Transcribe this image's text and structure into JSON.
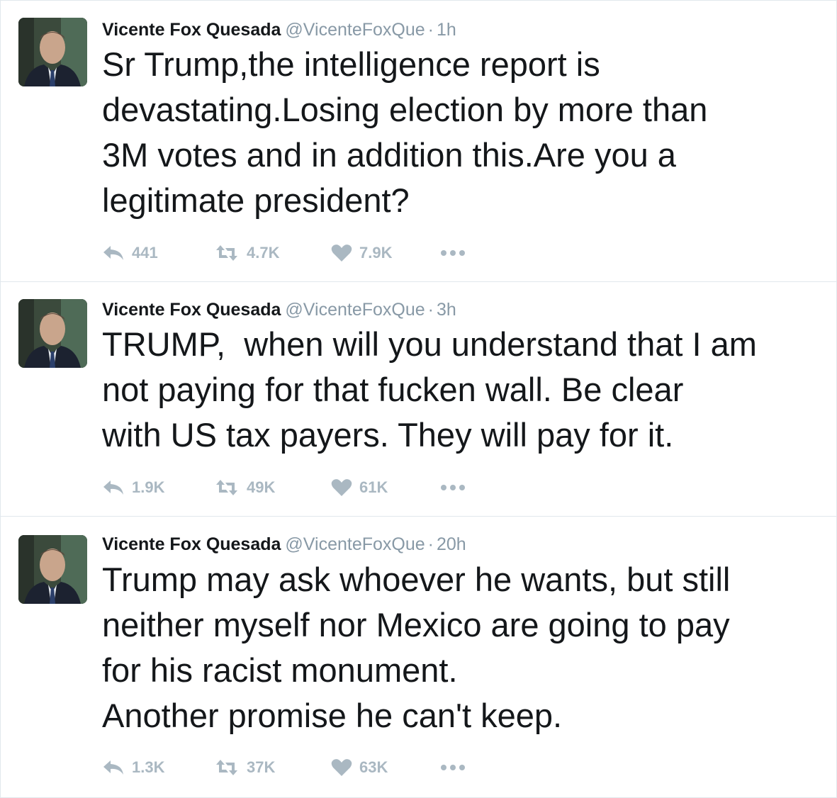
{
  "tweets": [
    {
      "name": "Vicente Fox Quesada",
      "handle": "@VicenteFoxQue",
      "separator": "·",
      "time": "1h",
      "text": "Sr Trump,the intelligence report is\ndevastating.Losing election by more than\n3M votes and in addition this.Are you a\nlegitimate president?",
      "replies": "441",
      "retweets": "4.7K",
      "likes": "7.9K"
    },
    {
      "name": "Vicente Fox Quesada",
      "handle": "@VicenteFoxQue",
      "separator": "·",
      "time": "3h",
      "text": "TRUMP,  when will you understand that I am\nnot paying for that fucken wall. Be clear\nwith US tax payers. They will pay for it.",
      "replies": "1.9K",
      "retweets": "49K",
      "likes": "61K"
    },
    {
      "name": "Vicente Fox Quesada",
      "handle": "@VicenteFoxQue",
      "separator": "·",
      "time": "20h",
      "text": "Trump may ask whoever he wants, but still\nneither myself nor Mexico are going to pay\nfor his racist monument.\nAnother promise he can't keep.",
      "replies": "1.3K",
      "retweets": "37K",
      "likes": "63K"
    }
  ],
  "colors": {
    "text": "#14171a",
    "secondary": "#8899a6",
    "action": "#aab8c2",
    "border": "#e1e8ed"
  }
}
